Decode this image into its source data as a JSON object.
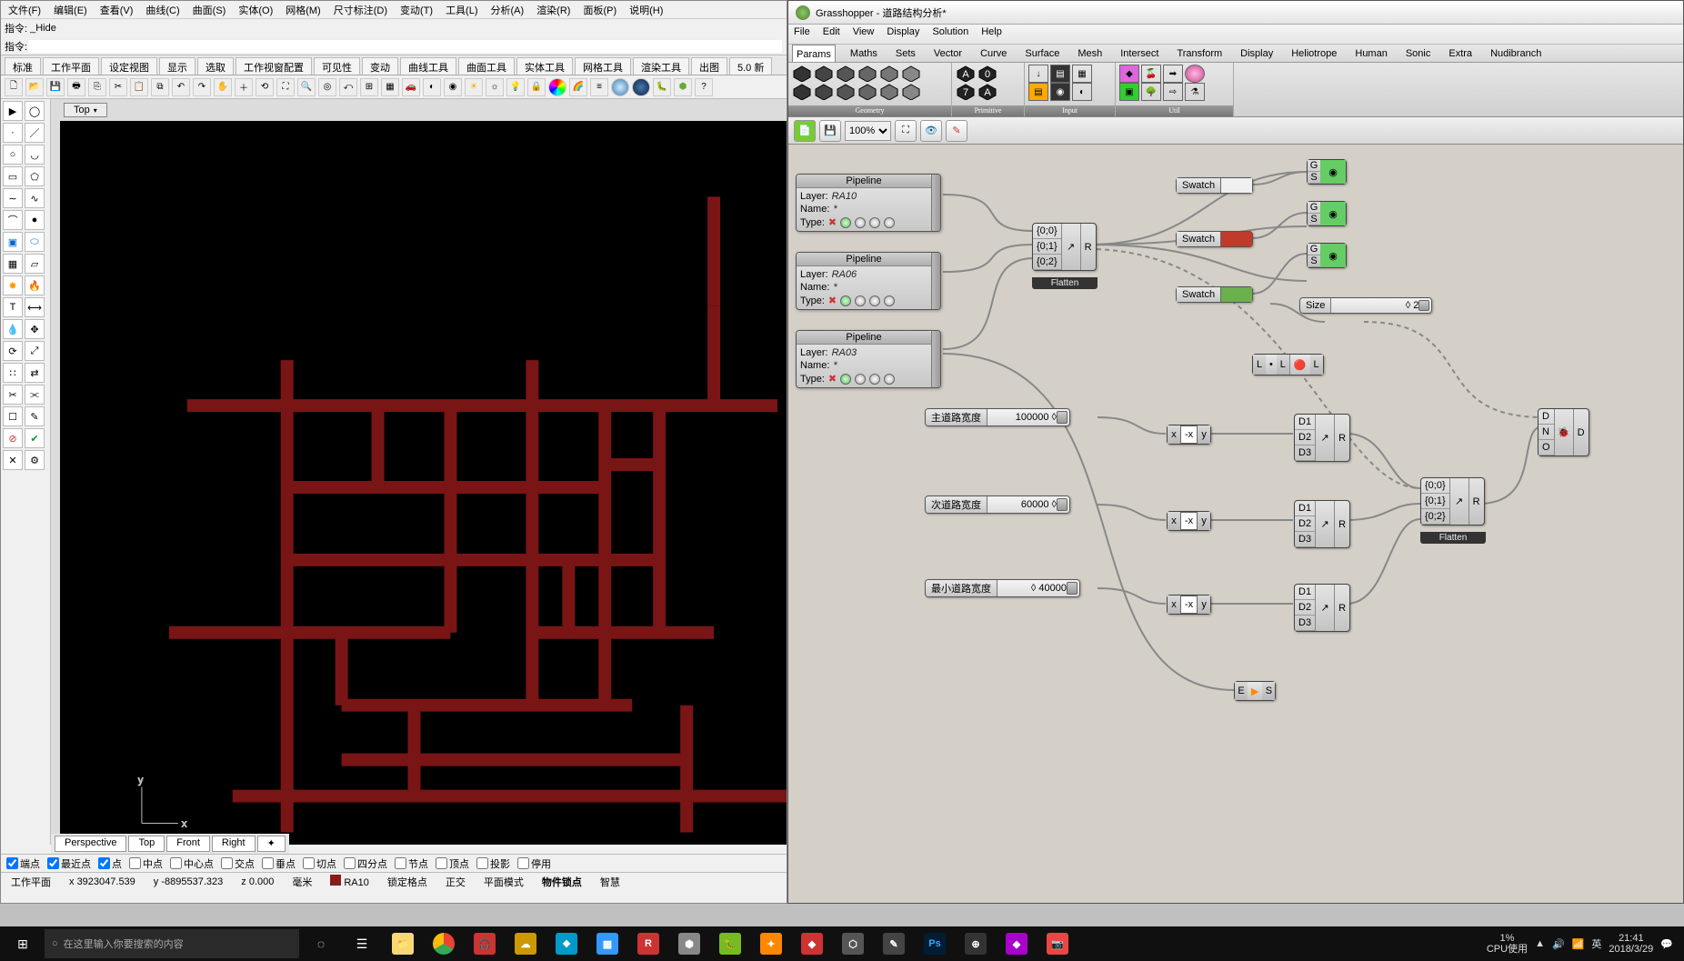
{
  "rhino": {
    "menubar": [
      "文件(F)",
      "编辑(E)",
      "查看(V)",
      "曲线(C)",
      "曲面(S)",
      "实体(O)",
      "网格(M)",
      "尺寸标注(D)",
      "变动(T)",
      "工具(L)",
      "分析(A)",
      "渲染(R)",
      "面板(P)",
      "说明(H)"
    ],
    "cmd_label": "指令:",
    "cmd_last": "_Hide",
    "toolbar_tabs": [
      "标准",
      "工作平面",
      "设定视图",
      "显示",
      "选取",
      "工作视窗配置",
      "可见性",
      "变动",
      "曲线工具",
      "曲面工具",
      "实体工具",
      "网格工具",
      "渲染工具",
      "出图",
      "5.0 新"
    ],
    "vp_title": "Top",
    "vp_tabs": [
      "Perspective",
      "Top",
      "Front",
      "Right",
      "✦"
    ],
    "osnaps": [
      {
        "l": "端点",
        "c": true
      },
      {
        "l": "最近点",
        "c": true
      },
      {
        "l": "点",
        "c": true
      },
      {
        "l": "中点",
        "c": false
      },
      {
        "l": "中心点",
        "c": false
      },
      {
        "l": "交点",
        "c": false
      },
      {
        "l": "垂点",
        "c": false
      },
      {
        "l": "切点",
        "c": false
      },
      {
        "l": "四分点",
        "c": false
      },
      {
        "l": "节点",
        "c": false
      },
      {
        "l": "顶点",
        "c": false
      },
      {
        "l": "投影",
        "c": false
      },
      {
        "l": "停用",
        "c": false
      }
    ],
    "status": {
      "plane": "工作平面",
      "x_lbl": "x",
      "x": "3923047.539",
      "y_lbl": "y",
      "y": "-8895537.323",
      "z_lbl": "z",
      "z": "0.000",
      "unit": "毫米",
      "layer": "RA10",
      "grid": "锁定格点",
      "ortho": "正交",
      "planar": "平面模式",
      "osnap": "物件锁点",
      "smart": "智慧"
    }
  },
  "gh": {
    "title": "Grasshopper - 道路结构分析*",
    "menus": [
      "File",
      "Edit",
      "View",
      "Display",
      "Solution",
      "Help"
    ],
    "tabs": [
      "Params",
      "Maths",
      "Sets",
      "Vector",
      "Curve",
      "Surface",
      "Mesh",
      "Intersect",
      "Transform",
      "Display",
      "Heliotrope",
      "Human",
      "Sonic",
      "Extra",
      "Nudibranch"
    ],
    "shelf_groups": [
      "Geometry",
      "Primitive",
      "Input",
      "Util"
    ],
    "zoom": "100%",
    "pipelines": [
      {
        "title": "Pipeline",
        "layer": "RA10",
        "name": "*",
        "type": ""
      },
      {
        "title": "Pipeline",
        "layer": "RA06",
        "name": "*",
        "type": ""
      },
      {
        "title": "Pipeline",
        "layer": "RA03",
        "name": "*",
        "type": ""
      }
    ],
    "entwine": {
      "branches": [
        "{0;0}",
        "{0;1}",
        "{0;2}"
      ],
      "out": "R",
      "flatten": "Flatten"
    },
    "entwine2": {
      "branches": [
        "{0;0}",
        "{0;1}",
        "{0;2}"
      ],
      "out": "R",
      "flatten": "Flatten"
    },
    "swatches": [
      {
        "label": "Swatch",
        "color": "#f0f0f0"
      },
      {
        "label": "Swatch",
        "color": "#c03a2a"
      },
      {
        "label": "Swatch",
        "color": "#6ab04c"
      }
    ],
    "size": {
      "label": "Size",
      "value": "◊ 2"
    },
    "dotc": {
      "in": [
        "L",
        "L"
      ],
      "out": "L"
    },
    "sliders": [
      {
        "label": "主道路宽度",
        "value": "100000 ◊"
      },
      {
        "label": "次道路宽度",
        "value": "60000 ◊"
      },
      {
        "label": "最小道路宽度",
        "value": "◊ 40000"
      }
    ],
    "neg": {
      "in": "x",
      "mid": "-x",
      "out": "y"
    },
    "merge": {
      "D1": "D1",
      "D2": "D2",
      "D3": "D3",
      "out": "R"
    },
    "flow": {
      "in": "E",
      "out": "S"
    },
    "cdisp": {
      "D": "D",
      "N": "N",
      "O": "O",
      "mid": "D",
      "out": ""
    }
  },
  "taskbar": {
    "search_placeholder": "在这里输入你要搜索的内容",
    "cpu_lbl": "CPU使用",
    "cpu": "1%",
    "ime": "英",
    "time": "21:41",
    "date": "2018/3/29"
  }
}
